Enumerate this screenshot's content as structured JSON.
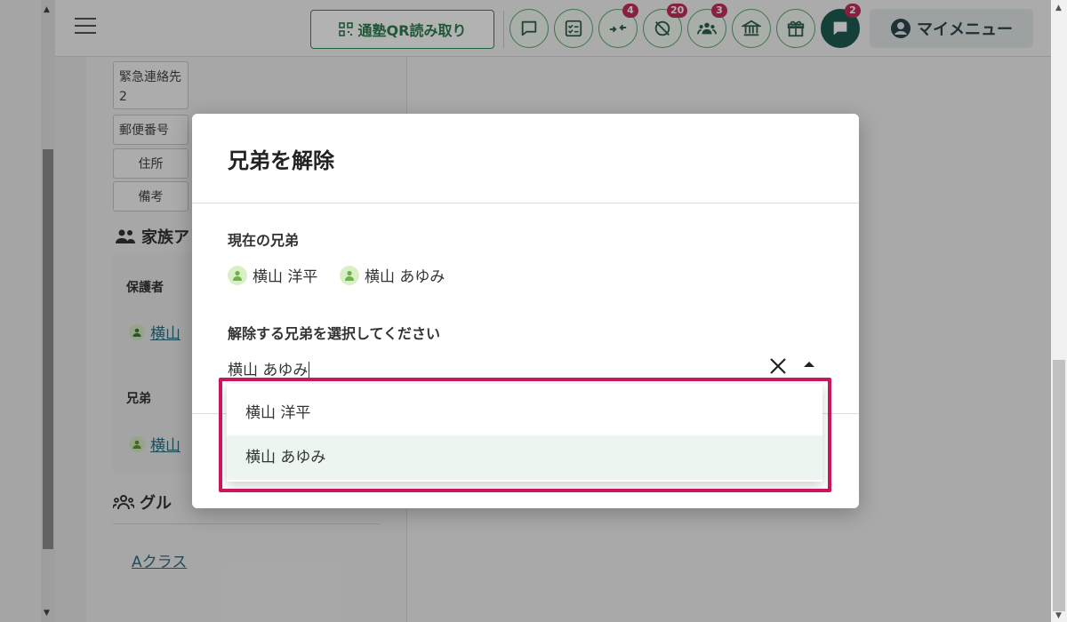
{
  "header": {
    "qr_button_label": "通塾QR読み取り",
    "icon_buttons": [
      {
        "name": "message-icon",
        "badge": ""
      },
      {
        "name": "checklist-icon",
        "badge": ""
      },
      {
        "name": "arrows-in-icon",
        "badge": "4"
      },
      {
        "name": "no-entry-icon",
        "badge": "20"
      },
      {
        "name": "group-icon",
        "badge": "3"
      },
      {
        "name": "school-icon",
        "badge": ""
      },
      {
        "name": "gift-icon",
        "badge": ""
      },
      {
        "name": "chat-icon",
        "badge": "2"
      }
    ],
    "my_menu_label": "マイメニュー"
  },
  "left_panel": {
    "chips": [
      "緊急連絡先",
      "2",
      "郵便番号",
      "住所",
      "備考"
    ],
    "family_heading": "家族ア",
    "guardian_label": "保護者",
    "guardian_name": "横山 ",
    "sibling_label": "兄弟",
    "sibling_name": "横山 ",
    "group_heading": "グル",
    "group_link": "Aクラス"
  },
  "modal": {
    "title": "兄弟を解除",
    "current_label": "現在の兄弟",
    "current_siblings": [
      "横山 洋平",
      "横山 あゆみ"
    ],
    "select_label": "解除する兄弟を選択してください",
    "select_value": "横山 あゆみ",
    "options": [
      "横山 洋平",
      "横山 あゆみ"
    ],
    "selected_option_index": 1
  },
  "colors": {
    "accent": "#2e8b57",
    "badge": "#c62f5b",
    "highlight_border": "#c8175d",
    "selected_option_bg": "#ecf5ef"
  }
}
